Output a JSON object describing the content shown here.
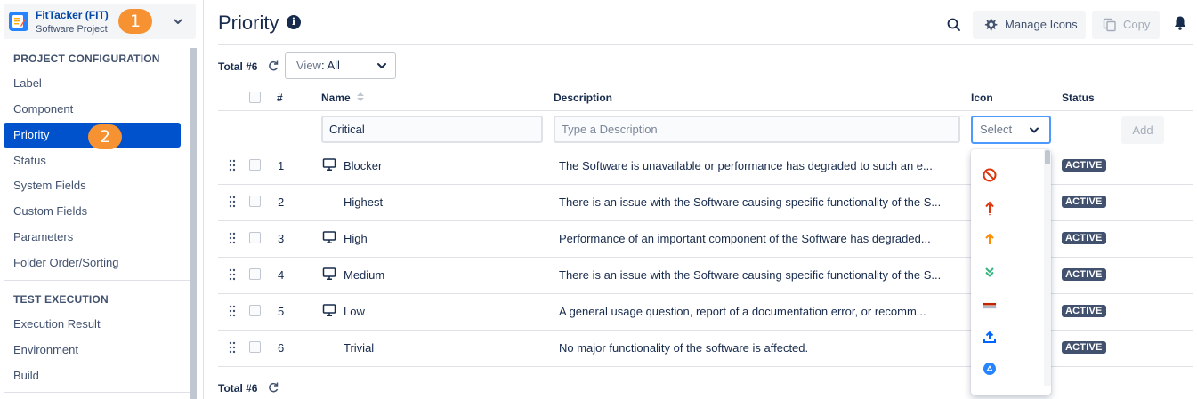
{
  "project": {
    "name": "FitTacker (FIT)",
    "type": "Software Project",
    "callout_1": "1",
    "callout_2": "2"
  },
  "sidebar": {
    "sections": [
      {
        "title": "PROJECT CONFIGURATION",
        "items": [
          "Label",
          "Component",
          "Priority",
          "Status",
          "System Fields",
          "Custom Fields",
          "Parameters",
          "Folder Order/Sorting"
        ]
      },
      {
        "title": "TEST EXECUTION",
        "items": [
          "Execution Result",
          "Environment",
          "Build"
        ]
      }
    ],
    "active_item": "Priority"
  },
  "header": {
    "title": "Priority",
    "info_icon": "i",
    "manage_icons_label": "Manage Icons",
    "copy_label": "Copy"
  },
  "toolbar": {
    "total_label": "Total #6",
    "view_key": "View",
    "view_value": ": All"
  },
  "table": {
    "columns": {
      "num": "#",
      "name": "Name",
      "description": "Description",
      "icon": "Icon",
      "status": "Status"
    },
    "new_row": {
      "name_value": "Critical",
      "description_placeholder": "Type a Description",
      "icon_select_label": "Select",
      "add_label": "Add"
    },
    "rows": [
      {
        "num": "1",
        "name": "Blocker",
        "has_icon": true,
        "description": "The Software is unavailable or performance has degraded to such an e...",
        "status": "ACTIVE"
      },
      {
        "num": "2",
        "name": "Highest",
        "has_icon": false,
        "description": "There is an issue with the Software causing specific functionality of the S...",
        "status": "ACTIVE"
      },
      {
        "num": "3",
        "name": "High",
        "has_icon": true,
        "description": "Performance of an important component of the Software has degraded...",
        "status": "ACTIVE"
      },
      {
        "num": "4",
        "name": "Medium",
        "has_icon": true,
        "description": "There is an issue with the Software causing specific functionality of the S...",
        "status": "ACTIVE"
      },
      {
        "num": "5",
        "name": "Low",
        "has_icon": true,
        "description": "A general usage question, report of a documentation error, or recomm...",
        "status": "ACTIVE"
      },
      {
        "num": "6",
        "name": "Trivial",
        "has_icon": false,
        "description": "No major functionality of the software is affected.",
        "status": "ACTIVE"
      }
    ]
  },
  "footer": {
    "total_label": "Total #6"
  },
  "icon_dropdown": {
    "options": [
      "blocked-icon",
      "highest-arrow-icon",
      "high-arrow-icon",
      "lowest-double-chevron-icon",
      "latest-label-icon",
      "upload-icon",
      "triangle-circle-icon"
    ]
  },
  "colors": {
    "accent": "#0052cc",
    "callout": "#f79232",
    "status_badge": "#42526e",
    "focus_border": "#4c9aff"
  }
}
